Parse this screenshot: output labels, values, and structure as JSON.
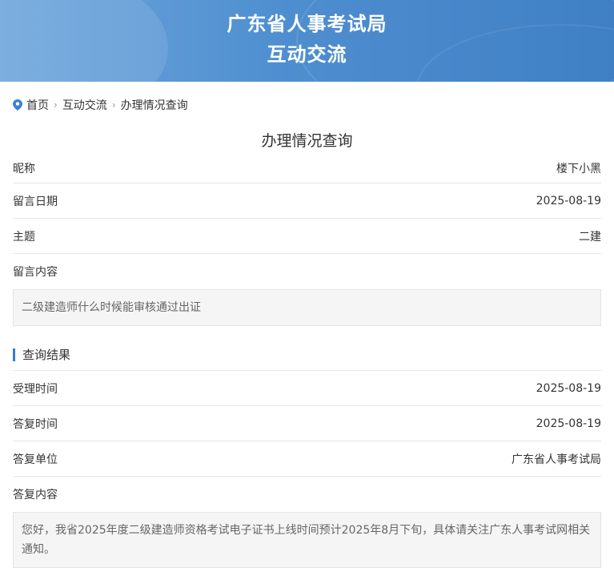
{
  "banner": {
    "title_line1": "广东省人事考试局",
    "title_line2": "互动交流"
  },
  "breadcrumb": {
    "icon": "location-pin-icon",
    "items": [
      "首页",
      "互动交流",
      "办理情况查询"
    ],
    "separator": "›"
  },
  "page_title": "办理情况查询",
  "message": {
    "nickname_label": "昵称",
    "nickname_value": "楼下小黑",
    "date_label": "留言日期",
    "date_value": "2025-08-19",
    "subject_label": "主题",
    "subject_value": "二建",
    "content_label": "留言内容",
    "content_value": "二级建造师什么时候能审核通过出证"
  },
  "result": {
    "section_title": "查询结果",
    "accept_time_label": "受理时间",
    "accept_time_value": "2025-08-19",
    "reply_time_label": "答复时间",
    "reply_time_value": "2025-08-19",
    "reply_unit_label": "答复单位",
    "reply_unit_value": "广东省人事考试局",
    "reply_content_label": "答复内容",
    "reply_content_value": "您好，我省2025年度二级建造师资格考试电子证书上线时间预计2025年8月下旬，具体请关注广东人事考试网相关通知。"
  },
  "colors": {
    "banner_start": "#6ea6dc",
    "banner_end": "#3f7fc4",
    "accent": "#2f7fd0",
    "content_bg": "#f5f5f5"
  }
}
